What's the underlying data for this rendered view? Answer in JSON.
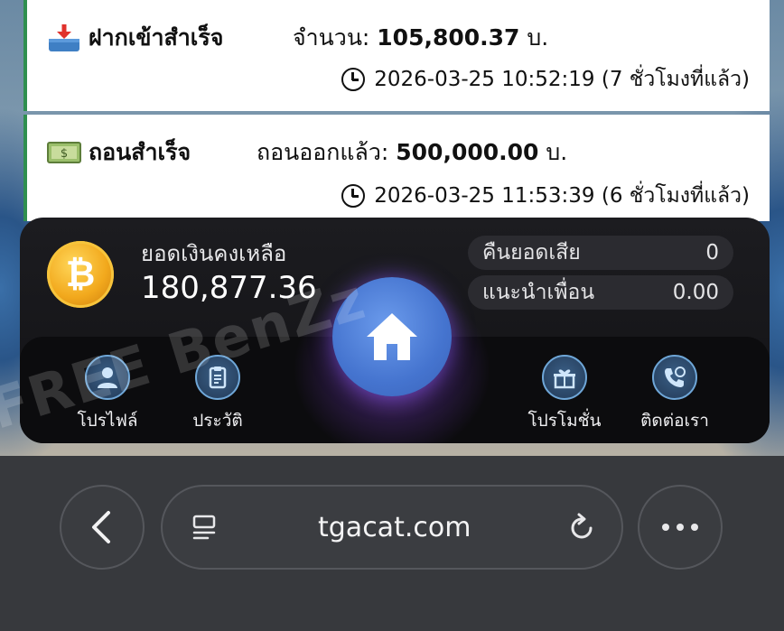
{
  "deposit": {
    "title": "ฝากเข้าสำเร็จ",
    "amount_label": "จำนวน:",
    "amount": "105,800.37",
    "currency": "บ.",
    "datetime": "2026-03-25 10:52:19",
    "ago": "(7 ชั่วโมงที่แล้ว)"
  },
  "withdraw": {
    "title": "ถอนสำเร็จ",
    "amount_label": "ถอนออกแล้ว:",
    "amount": "500,000.00",
    "currency": "บ.",
    "datetime": "2026-03-25 11:53:39",
    "ago": "(6 ชั่วโมงที่แล้ว)"
  },
  "balance": {
    "label": "ยอดเงินคงเหลือ",
    "value": "180,877.36",
    "coin_symbol": "₿"
  },
  "stats": [
    {
      "label": "คืนยอดเสีย",
      "value": "0"
    },
    {
      "label": "แนะนำเพื่อน",
      "value": "0.00"
    }
  ],
  "menu": {
    "profile": "โปรไฟล์",
    "history": "ประวัติ",
    "promotion": "โปรโมชั่น",
    "contact": "ติดต่อเรา"
  },
  "browser": {
    "url": "tgacat.com"
  },
  "watermark": "FREE BenZz",
  "colors": {
    "accent_green": "#2f8f4f",
    "home_blue": "#4574cf",
    "coin_gold": "#f2a91d"
  }
}
